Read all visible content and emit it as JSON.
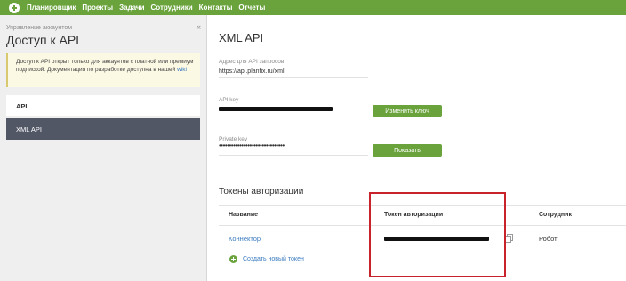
{
  "topnav": {
    "items": [
      "Планировщик",
      "Проекты",
      "Задачи",
      "Сотрудники",
      "Контакты",
      "Отчеты"
    ]
  },
  "sidebar": {
    "breadcrumb": "Управление аккаунтом",
    "title": "Доступ к API",
    "collapse_glyph": "«",
    "notice_text": "Доступ к API открыт только для аккаунтов с платной или премиум подпиской. Документация по разработке доступна в нашей",
    "notice_link": "wiki",
    "menu": [
      {
        "label": "API",
        "active": false
      },
      {
        "label": "XML API",
        "active": true
      }
    ]
  },
  "main": {
    "title": "XML API",
    "address": {
      "label": "Адрес для API запросов",
      "value": "https://api.planfix.ru/xml"
    },
    "api_key": {
      "label": "API key",
      "masked": true,
      "button": "Изменить ключ"
    },
    "private_key": {
      "label": "Private key",
      "value": "••••••••••••••••••••••••••••••••",
      "button": "Показать"
    },
    "tokens": {
      "title": "Токены авторизации",
      "columns": [
        "Название",
        "Токен авторизации",
        "Сотрудник"
      ],
      "rows": [
        {
          "name": "Коннектор",
          "token_masked": true,
          "employee": "Робот"
        }
      ],
      "add_label": "Создать новый токен"
    }
  },
  "colors": {
    "brand_green": "#6aa33c",
    "link_blue": "#3a7bbf",
    "active_menu_bg": "#525766",
    "highlight_red": "#c8232c"
  }
}
